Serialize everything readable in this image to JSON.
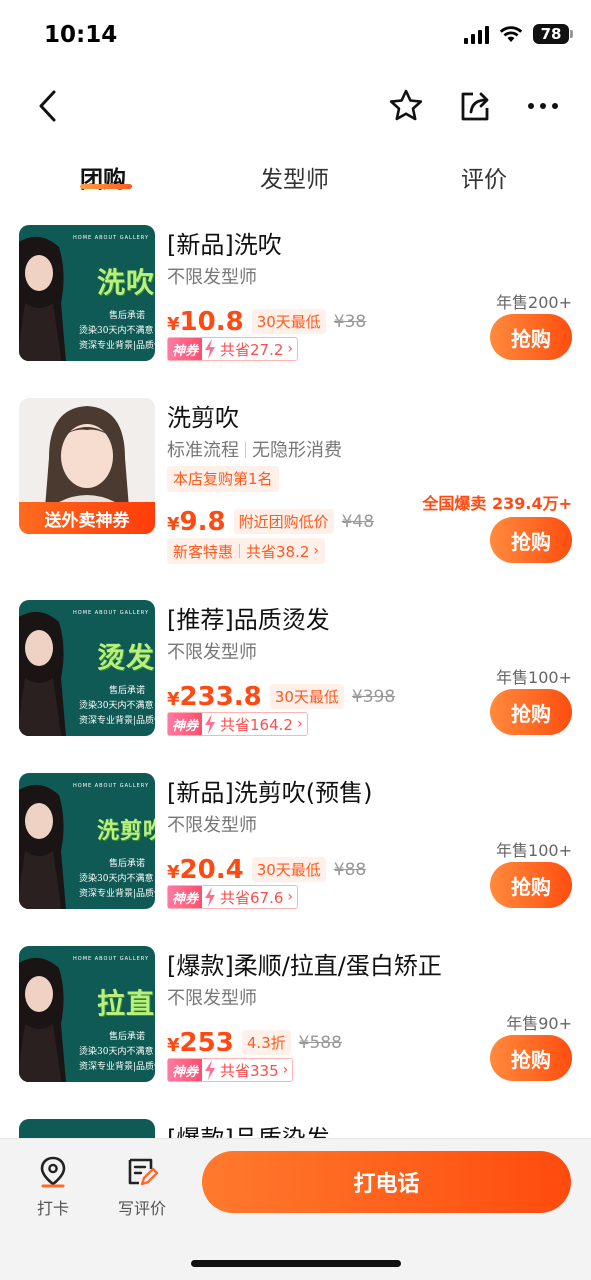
{
  "status_bar": {
    "time": "10:14",
    "battery": "78"
  },
  "nav": {
    "icons": [
      "back-icon",
      "star-icon",
      "share-icon",
      "more-icon"
    ]
  },
  "tabs": [
    {
      "label": "团购",
      "active": true
    },
    {
      "label": "发型师",
      "active": false
    },
    {
      "label": "评价",
      "active": false
    }
  ],
  "deals": [
    {
      "title": "[新品]洗吹",
      "subtitle": "不限发型师",
      "thumb_word": "洗吹",
      "currency": "¥",
      "price": "10.8",
      "price_label": "30天最低",
      "original_price": "¥38",
      "coupon_badge": "神券",
      "coupon_save": "共省27.2",
      "sales": "年售200+",
      "buy": "抢购"
    },
    {
      "title": "洗剪吹",
      "subtitle_parts": [
        "标准流程",
        "无隐形消费"
      ],
      "rank_tag": "本店复购第1名",
      "thumb_band": "送外卖神券",
      "currency": "¥",
      "price": "9.8",
      "price_label": "附近团购低价",
      "original_price": "¥48",
      "newcomer": "新客特惠",
      "newcomer_save": "共省38.2",
      "sales": "全国爆卖 239.4万+",
      "buy": "抢购"
    },
    {
      "title": "[推荐]品质烫发",
      "subtitle": "不限发型师",
      "thumb_word": "烫发",
      "currency": "¥",
      "price": "233.8",
      "price_label": "30天最低",
      "original_price": "¥398",
      "coupon_badge": "神券",
      "coupon_save": "共省164.2",
      "sales": "年售100+",
      "buy": "抢购"
    },
    {
      "title": "[新品]洗剪吹(预售)",
      "subtitle": "不限发型师",
      "thumb_word": "洗剪吹",
      "currency": "¥",
      "price": "20.4",
      "price_label": "30天最低",
      "original_price": "¥88",
      "coupon_badge": "神券",
      "coupon_save": "共省67.6",
      "sales": "年售100+",
      "buy": "抢购"
    },
    {
      "title": "[爆款]柔顺/拉直/蛋白矫正",
      "subtitle": "不限发型师",
      "thumb_word": "拉直",
      "currency": "¥",
      "price": "253",
      "price_label": "4.3折",
      "original_price": "¥588",
      "coupon_badge": "神券",
      "coupon_save": "共省335",
      "sales": "年售90+",
      "buy": "抢购"
    },
    {
      "title": "[爆款]品质染发"
    }
  ],
  "thumb_common": {
    "nav_text": "HOME  ABOUT  GALLERY",
    "lines": [
      "售后承诺",
      "烫染30天内不满意",
      "资深专业背景|品质保"
    ]
  },
  "bottom_bar": {
    "checkin": "打卡",
    "review": "写评价",
    "call": "打电话"
  },
  "colors": {
    "accent": "#ff4e0f",
    "teal": "#0f5a55"
  }
}
